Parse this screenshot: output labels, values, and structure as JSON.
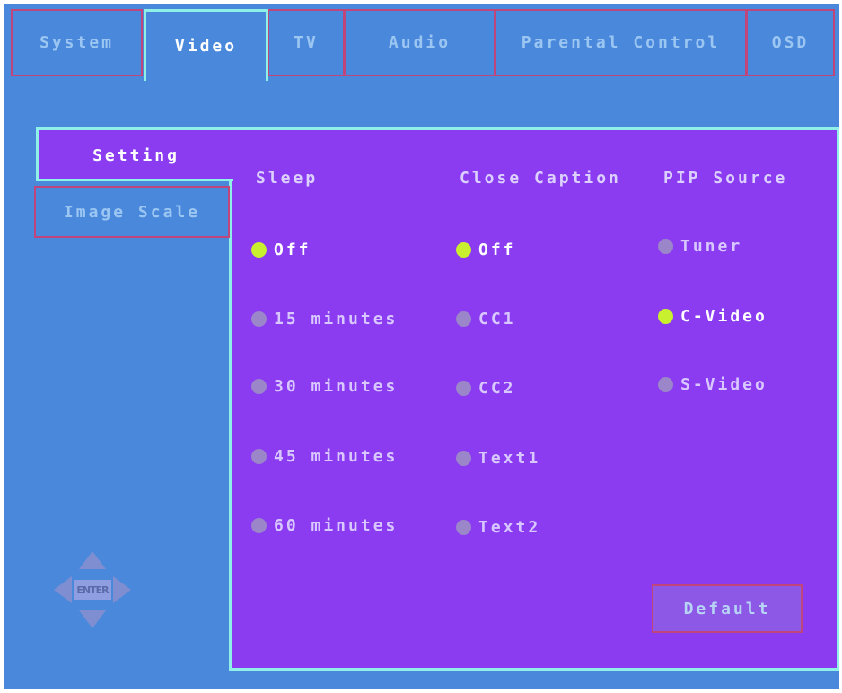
{
  "tabs": [
    {
      "label": "System",
      "active": false
    },
    {
      "label": "Video",
      "active": true
    },
    {
      "label": "TV",
      "active": false
    },
    {
      "label": "Audio",
      "active": false
    },
    {
      "label": "Parental Control",
      "active": false
    },
    {
      "label": "OSD",
      "active": false
    }
  ],
  "subtabs": [
    {
      "label": "Setting",
      "active": true
    },
    {
      "label": "Image Scale",
      "active": false
    }
  ],
  "sleep": {
    "header": "Sleep",
    "options": [
      "Off",
      "15 minutes",
      "30 minutes",
      "45 minutes",
      "60 minutes"
    ],
    "selected": "Off"
  },
  "close_caption": {
    "header": "Close Caption",
    "options": [
      "Off",
      "CC1",
      "CC2",
      "Text1",
      "Text2"
    ],
    "selected": "Off"
  },
  "pip_source": {
    "header": "PIP Source",
    "options": [
      "Tuner",
      "C-Video",
      "S-Video"
    ],
    "selected": "C-Video"
  },
  "default_button": "Default",
  "enter_pad": {
    "label": "ENTER",
    "icon": "dpad-arrows-icon"
  },
  "colors": {
    "background": "#4a88dc",
    "panel": "#8b3cf0",
    "highlight_border": "#8ff0e8",
    "tab_border": "#c0457a",
    "selected_dot": "#c8f02e",
    "unselected_dot": "#9a86c8"
  }
}
